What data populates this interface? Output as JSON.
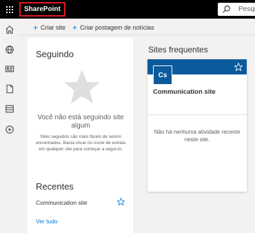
{
  "suite": {
    "brand": "SharePoint",
    "search_placeholder": "Pesqu"
  },
  "rail": {
    "icons": [
      "home-icon",
      "globe-icon",
      "news-icon",
      "file-icon",
      "list-icon",
      "add-icon"
    ]
  },
  "commands": {
    "create_site": "Criar site",
    "create_news": "Criar postagem de notícias"
  },
  "following": {
    "title": "Seguindo",
    "empty_title": "Você não está seguindo site algum",
    "empty_desc": "Sites seguidos são mais fáceis de serem encontrados. Basta clicar no ícone de estrela em qualquer site para começar a segui-lo."
  },
  "recent": {
    "title": "Recentes",
    "items": [
      {
        "label": "Communication site"
      }
    ],
    "see_all": "Ver tudo"
  },
  "frequent": {
    "title": "Sites frequentes",
    "cards": [
      {
        "logo": "Cs",
        "title": "Communication site",
        "activity": "Não há nenhuma atividade recente neste site."
      }
    ]
  },
  "colors": {
    "accent": "#0078d4",
    "banner": "#0b5a9c",
    "highlight": "#e01b22"
  }
}
